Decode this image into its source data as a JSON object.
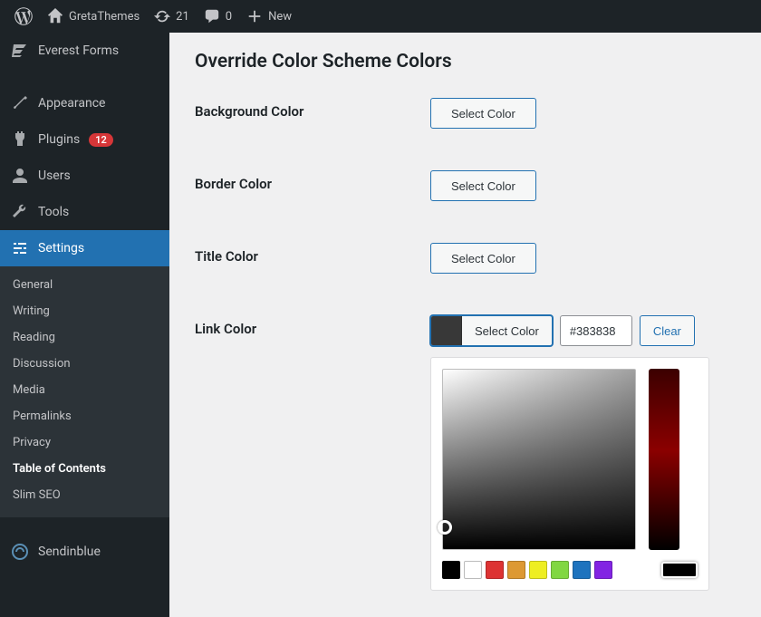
{
  "adminbar": {
    "site_name": "GretaThemes",
    "updates": "21",
    "comments": "0",
    "new_label": "New"
  },
  "sidebar": {
    "everest_forms": "Everest Forms",
    "appearance": "Appearance",
    "plugins": "Plugins",
    "plugins_badge": "12",
    "users": "Users",
    "tools": "Tools",
    "settings": "Settings",
    "submenu": {
      "general": "General",
      "writing": "Writing",
      "reading": "Reading",
      "discussion": "Discussion",
      "media": "Media",
      "permalinks": "Permalinks",
      "privacy": "Privacy",
      "toc": "Table of Contents",
      "slimseo": "Slim SEO"
    },
    "sendinblue": "Sendinblue"
  },
  "main": {
    "section_title": "Override Color Scheme Colors",
    "fields": {
      "background": {
        "label": "Background Color",
        "button": "Select Color"
      },
      "border": {
        "label": "Border Color",
        "button": "Select Color"
      },
      "title": {
        "label": "Title Color",
        "button": "Select Color"
      },
      "link": {
        "label": "Link Color",
        "button": "Select Color",
        "hex": "#383838",
        "clear": "Clear"
      }
    },
    "picker": {
      "swatches": [
        "#000000",
        "#ffffff",
        "#dd3333",
        "#dd9933",
        "#eeee22",
        "#81d742",
        "#1e73be",
        "#8224e3"
      ]
    }
  }
}
